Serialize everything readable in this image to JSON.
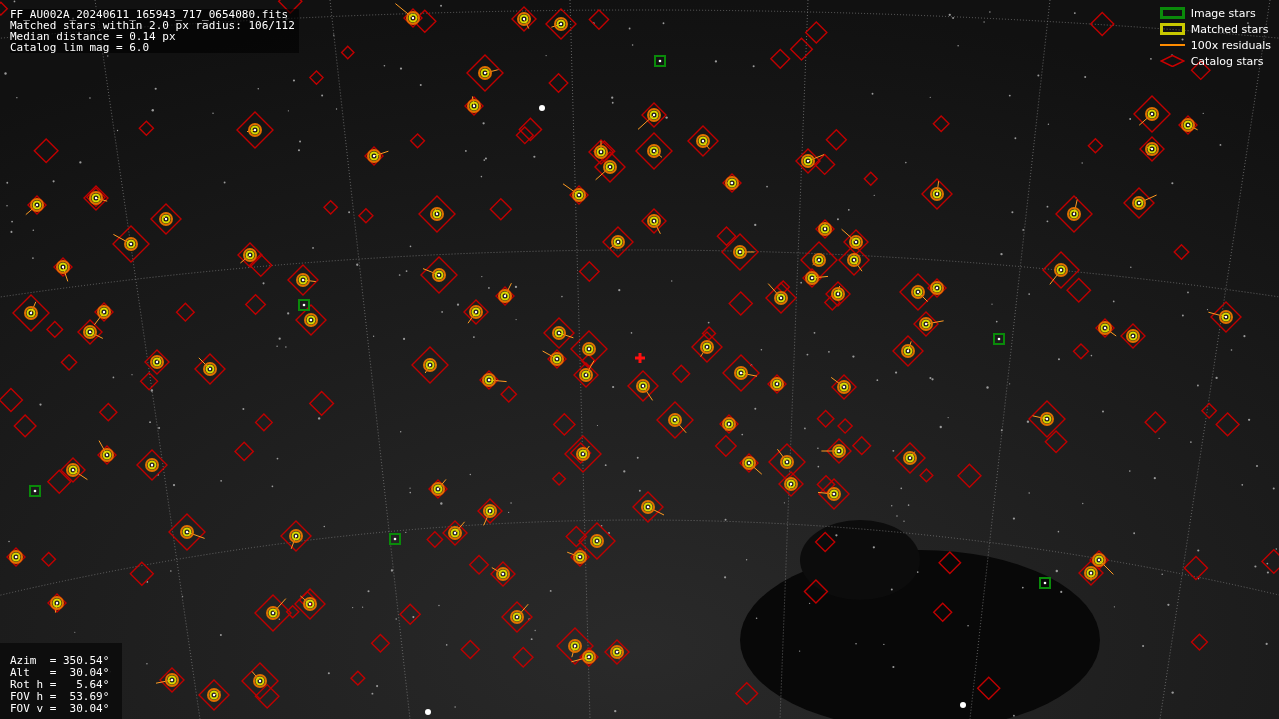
{
  "file_info": {
    "lines": [
      "FF_AU002A_20240611_165943_717_0654080.fits",
      "Matched stars within 2.0 px radius: 106/112",
      "Median distance = 0.14 px",
      "Catalog lim mag = 6.0"
    ]
  },
  "legend": [
    {
      "label": "Image stars",
      "kind": "box",
      "color": "#0a8a0a"
    },
    {
      "label": "Matched stars",
      "kind": "box",
      "color": "#c8c800"
    },
    {
      "label": "100x residuals",
      "kind": "line",
      "color": "#ff8c00"
    },
    {
      "label": "Catalog stars",
      "kind": "diamond",
      "color": "#cc0000"
    }
  ],
  "pointing": {
    "lines": [
      "Azim  = 350.54°",
      "Alt   =  30.04°",
      "Rot h =   5.64°",
      "FOV h =  53.69°",
      "FOV v =  30.04°"
    ]
  }
}
